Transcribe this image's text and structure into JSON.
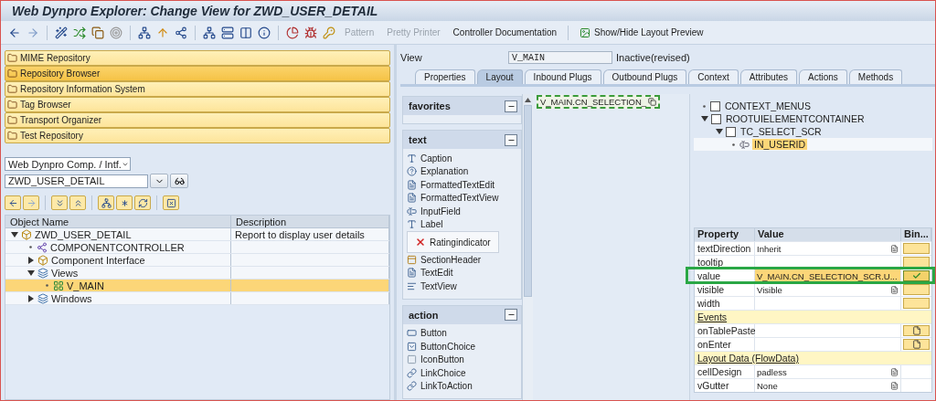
{
  "window": {
    "title": "Web Dynpro Explorer: Change View for ZWD_USER_DETAIL"
  },
  "toolbar": {
    "text_buttons": [
      {
        "label": "Pattern",
        "disabled": true
      },
      {
        "label": "Pretty Printer",
        "disabled": true
      },
      {
        "label": "Controller Documentation",
        "disabled": false
      },
      {
        "label": "Show/Hide Layout Preview",
        "disabled": false
      }
    ]
  },
  "repository_buttons": [
    {
      "label": "MIME Repository",
      "selected": false
    },
    {
      "label": "Repository Browser",
      "selected": true
    },
    {
      "label": "Repository Information System",
      "selected": false
    },
    {
      "label": "Tag Browser",
      "selected": false
    },
    {
      "label": "Transport Organizer",
      "selected": false
    },
    {
      "label": "Test Repository",
      "selected": false
    }
  ],
  "object_type": {
    "value": "Web Dynpro Comp. / Intf."
  },
  "object_name": {
    "value": "ZWD_USER_DETAIL"
  },
  "object_tree": {
    "columns": [
      "Object Name",
      "Description"
    ],
    "rows": [
      {
        "name": "ZWD_USER_DETAIL",
        "description": "Report to display user details",
        "kind": "component",
        "expandable": true,
        "expanded": true,
        "selected": false,
        "children": [
          {
            "name": "COMPONENTCONTROLLER",
            "kind": "controller",
            "expandable": false,
            "selected": false
          },
          {
            "name": "Component Interface",
            "kind": "component",
            "expandable": true,
            "expanded": false,
            "selected": false
          },
          {
            "name": "Views",
            "kind": "folder",
            "expandable": true,
            "expanded": true,
            "selected": false,
            "children": [
              {
                "name": "V_MAIN",
                "kind": "view",
                "expandable": false,
                "selected": true
              }
            ]
          },
          {
            "name": "Windows",
            "kind": "folder",
            "expandable": true,
            "expanded": false,
            "selected": false
          }
        ]
      }
    ]
  },
  "view": {
    "label": "View",
    "name": "V_MAIN",
    "status": "Inactive(revised)"
  },
  "tabs": [
    {
      "label": "Properties",
      "selected": false
    },
    {
      "label": "Layout",
      "selected": true
    },
    {
      "label": "Inbound Plugs",
      "selected": false
    },
    {
      "label": "Outbound Plugs",
      "selected": false
    },
    {
      "label": "Context",
      "selected": false
    },
    {
      "label": "Attributes",
      "selected": false
    },
    {
      "label": "Actions",
      "selected": false
    },
    {
      "label": "Methods",
      "selected": false
    }
  ],
  "palette": [
    {
      "title": "favorites"
    },
    {
      "title": "text",
      "items": [
        {
          "label": "Caption",
          "kind": "caption",
          "selected": false
        },
        {
          "label": "Explanation",
          "kind": "explanation",
          "selected": false
        },
        {
          "label": "FormattedTextEdit",
          "kind": "formatted",
          "selected": false
        },
        {
          "label": "FormattedTextView",
          "kind": "formatted",
          "selected": false
        },
        {
          "label": "InputField",
          "kind": "input",
          "selected": false
        },
        {
          "label": "Label",
          "kind": "caption",
          "selected": false
        },
        {
          "label": "Ratingindicator",
          "kind": "rating",
          "selected": true
        },
        {
          "label": "SectionHeader",
          "kind": "section",
          "selected": false
        },
        {
          "label": "TextEdit",
          "kind": "formatted",
          "selected": false
        },
        {
          "label": "TextView",
          "kind": "textview",
          "selected": false
        }
      ]
    },
    {
      "title": "action",
      "items": [
        {
          "label": "Button",
          "kind": "button",
          "selected": false
        },
        {
          "label": "ButtonChoice",
          "kind": "buttonchoice",
          "selected": false
        },
        {
          "label": "IconButton",
          "kind": "iconbutton",
          "selected": false
        },
        {
          "label": "LinkChoice",
          "kind": "link",
          "selected": false
        },
        {
          "label": "LinkToAction",
          "kind": "link",
          "selected": false
        }
      ]
    }
  ],
  "canvas": {
    "element": "V_MAIN.CN_SELECTION_"
  },
  "ui_tree": [
    {
      "name": "CONTEXT_MENUS",
      "kind": "container",
      "expandable": false,
      "selected": false
    },
    {
      "name": "ROOTUIELEMENTCONTAINER",
      "kind": "container",
      "expandable": true,
      "expanded": true,
      "selected": false,
      "children": [
        {
          "name": "TC_SELECT_SCR",
          "kind": "container",
          "expandable": true,
          "expanded": true,
          "selected": false,
          "children": [
            {
              "name": "IN_USERID",
              "kind": "input",
              "expandable": false,
              "selected": true
            }
          ]
        }
      ]
    }
  ],
  "properties": {
    "columns": [
      "Property",
      "Value",
      "Bin..."
    ],
    "rows": [
      {
        "kind": "property",
        "name": "textDirection",
        "value": "Inherit",
        "dropdown": true,
        "bind_button": true,
        "bound": false,
        "selected": false
      },
      {
        "kind": "property",
        "name": "tooltip",
        "dropdown": false,
        "bind_button": true,
        "bound": false,
        "selected": false
      },
      {
        "kind": "property",
        "name": "value",
        "value": "V_MAIN.CN_SELECTION_SCR.U...",
        "dropdown": false,
        "bind_button": true,
        "bound": true,
        "selected": true
      },
      {
        "kind": "property",
        "name": "visible",
        "value": "Visible",
        "dropdown": true,
        "bind_button": true,
        "bound": false,
        "selected": false
      },
      {
        "kind": "property",
        "name": "width",
        "dropdown": false,
        "bind_button": true,
        "bound": false,
        "selected": false
      },
      {
        "kind": "section",
        "name": "Events"
      },
      {
        "kind": "event",
        "name": "onTablePaste"
      },
      {
        "kind": "event",
        "name": "onEnter"
      },
      {
        "kind": "section",
        "name": "Layout Data (FlowData)"
      },
      {
        "kind": "property",
        "name": "cellDesign",
        "value": "padless",
        "dropdown": true,
        "bind_button": false,
        "selected": false
      },
      {
        "kind": "property",
        "name": "vGutter",
        "value": "None",
        "dropdown": true,
        "bind_button": false,
        "selected": false
      }
    ]
  }
}
